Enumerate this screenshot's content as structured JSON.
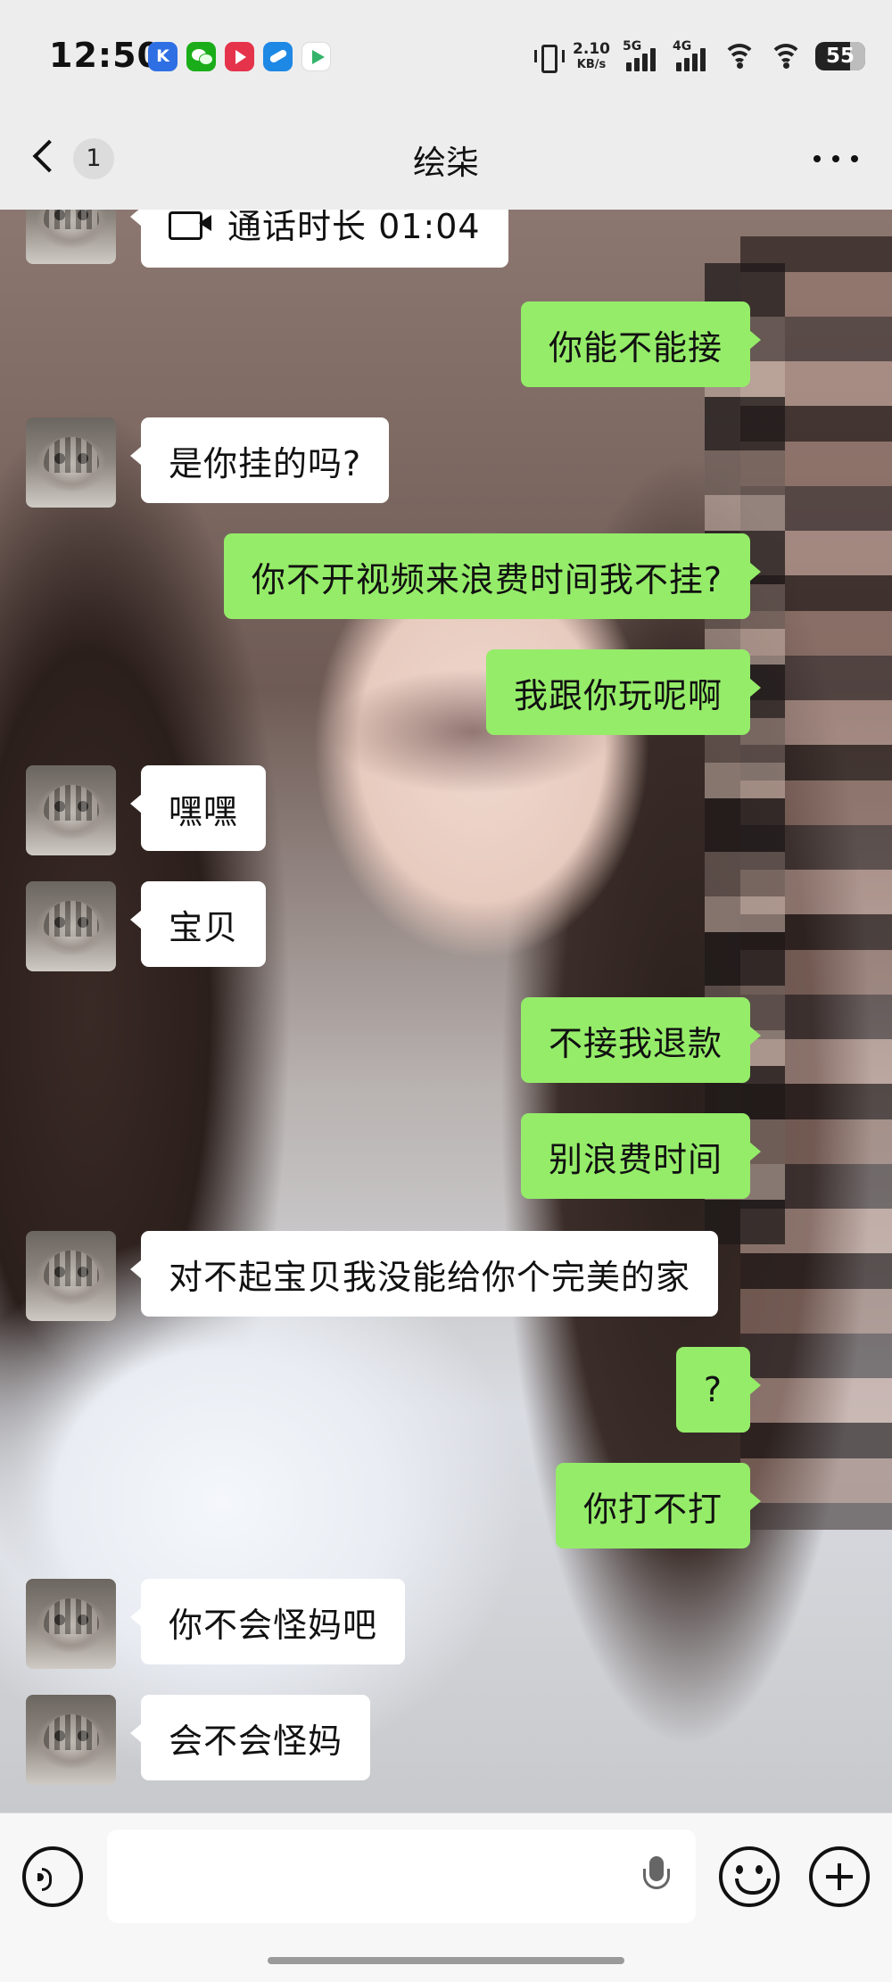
{
  "status_bar": {
    "time": "12:50",
    "net_speed_value": "2.10",
    "net_speed_unit": "KB/s",
    "signal_1_label": "5G",
    "signal_2_label": "4G",
    "battery": "55"
  },
  "nav": {
    "unread_count": "1",
    "title": "绘柒"
  },
  "messages": [
    {
      "side": "in",
      "text": "通话时长 01:04",
      "icon": "video-call-icon"
    },
    {
      "side": "out",
      "text": "你能不能接"
    },
    {
      "side": "in",
      "text": "是你挂的吗?"
    },
    {
      "side": "out",
      "text": "你不开视频来浪费时间我不挂?"
    },
    {
      "side": "out",
      "text": "我跟你玩呢啊"
    },
    {
      "side": "in",
      "text": "嘿嘿"
    },
    {
      "side": "in",
      "text": "宝贝"
    },
    {
      "side": "out",
      "text": "不接我退款"
    },
    {
      "side": "out",
      "text": "别浪费时间"
    },
    {
      "side": "in",
      "text": "对不起宝贝我没能给你个完美的家"
    },
    {
      "side": "out",
      "text": "?"
    },
    {
      "side": "out",
      "text": "你打不打"
    },
    {
      "side": "in",
      "text": "你不会怪妈吧"
    },
    {
      "side": "in",
      "text": "会不会怪妈"
    }
  ],
  "input": {
    "value": "",
    "placeholder": ""
  },
  "colors": {
    "outgoing_bubble": "#95ec69",
    "incoming_bubble": "#ffffff",
    "bar_background": "#ededed"
  }
}
